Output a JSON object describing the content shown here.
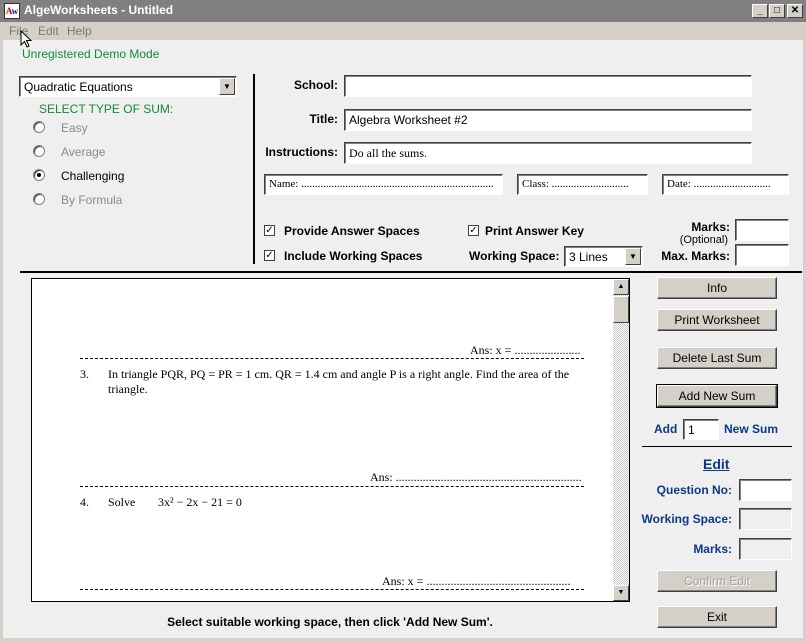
{
  "window": {
    "title": "AlgeWorksheets - Untitled",
    "icon": "app-logo-icon",
    "controls": [
      "minimize-icon",
      "maximize-icon",
      "close-icon"
    ]
  },
  "menu": {
    "items": [
      {
        "label": "File"
      },
      {
        "label": "Edit"
      },
      {
        "label": "Help"
      }
    ]
  },
  "mode_label": "Unregistered Demo Mode",
  "topic_select": {
    "value": "Quadratic Equations"
  },
  "sum_type": {
    "heading": "SELECT TYPE OF SUM:",
    "options": [
      {
        "label": "Easy",
        "selected": false
      },
      {
        "label": "Average",
        "selected": false
      },
      {
        "label": "Challenging",
        "selected": true
      },
      {
        "label": "By Formula",
        "selected": false
      }
    ]
  },
  "header_fields": {
    "school": {
      "label": "School:",
      "value": ""
    },
    "title": {
      "label": "Title:",
      "value": "Algebra Worksheet #2"
    },
    "instructions": {
      "label": "Instructions:",
      "value": "Do all the sums."
    },
    "name": {
      "value": "Name: ......................................................................"
    },
    "class": {
      "value": "Class: ............................"
    },
    "date": {
      "value": "Date: ............................"
    }
  },
  "options": {
    "provide_answer_spaces": {
      "label": "Provide Answer Spaces",
      "checked": true
    },
    "include_working_spaces": {
      "label": "Include Working Spaces",
      "checked": true
    },
    "print_answer_key": {
      "label": "Print Answer Key",
      "checked": true
    },
    "working_space": {
      "label": "Working Space:",
      "value": "3 Lines"
    },
    "marks": {
      "label": "Marks:",
      "sublabel": "(Optional)",
      "value": ""
    },
    "max_marks": {
      "label": "Max. Marks:",
      "value": ""
    }
  },
  "worksheet": {
    "items": [
      {
        "answer": "Ans: x = ......................"
      },
      {
        "number": "3.",
        "question_line1": "In triangle PQR, PQ = PR = 1 cm. QR = 1.4 cm and angle P is a right angle. Find the area of the",
        "question_line2": "triangle.",
        "answer": "Ans: .............................................................."
      },
      {
        "number": "4.",
        "verb": "Solve",
        "equation": "3x² − 2x − 21 = 0",
        "answer": "Ans: x = ................................................"
      }
    ]
  },
  "buttons": {
    "info": "Info",
    "print_worksheet": "Print Worksheet",
    "delete_last_sum": "Delete Last Sum",
    "add_new_sum": "Add New Sum",
    "confirm_edit": "Confirm Edit",
    "exit": "Exit"
  },
  "add_count": {
    "prefix": "Add",
    "value": "1",
    "suffix": "New Sum"
  },
  "edit_panel": {
    "heading": "Edit",
    "question_no": {
      "label": "Question No:",
      "value": ""
    },
    "working_space": {
      "label": "Working Space:",
      "value": ""
    },
    "marks": {
      "label": "Marks:",
      "value": ""
    }
  },
  "status": "Select suitable working space, then click 'Add New Sum'."
}
